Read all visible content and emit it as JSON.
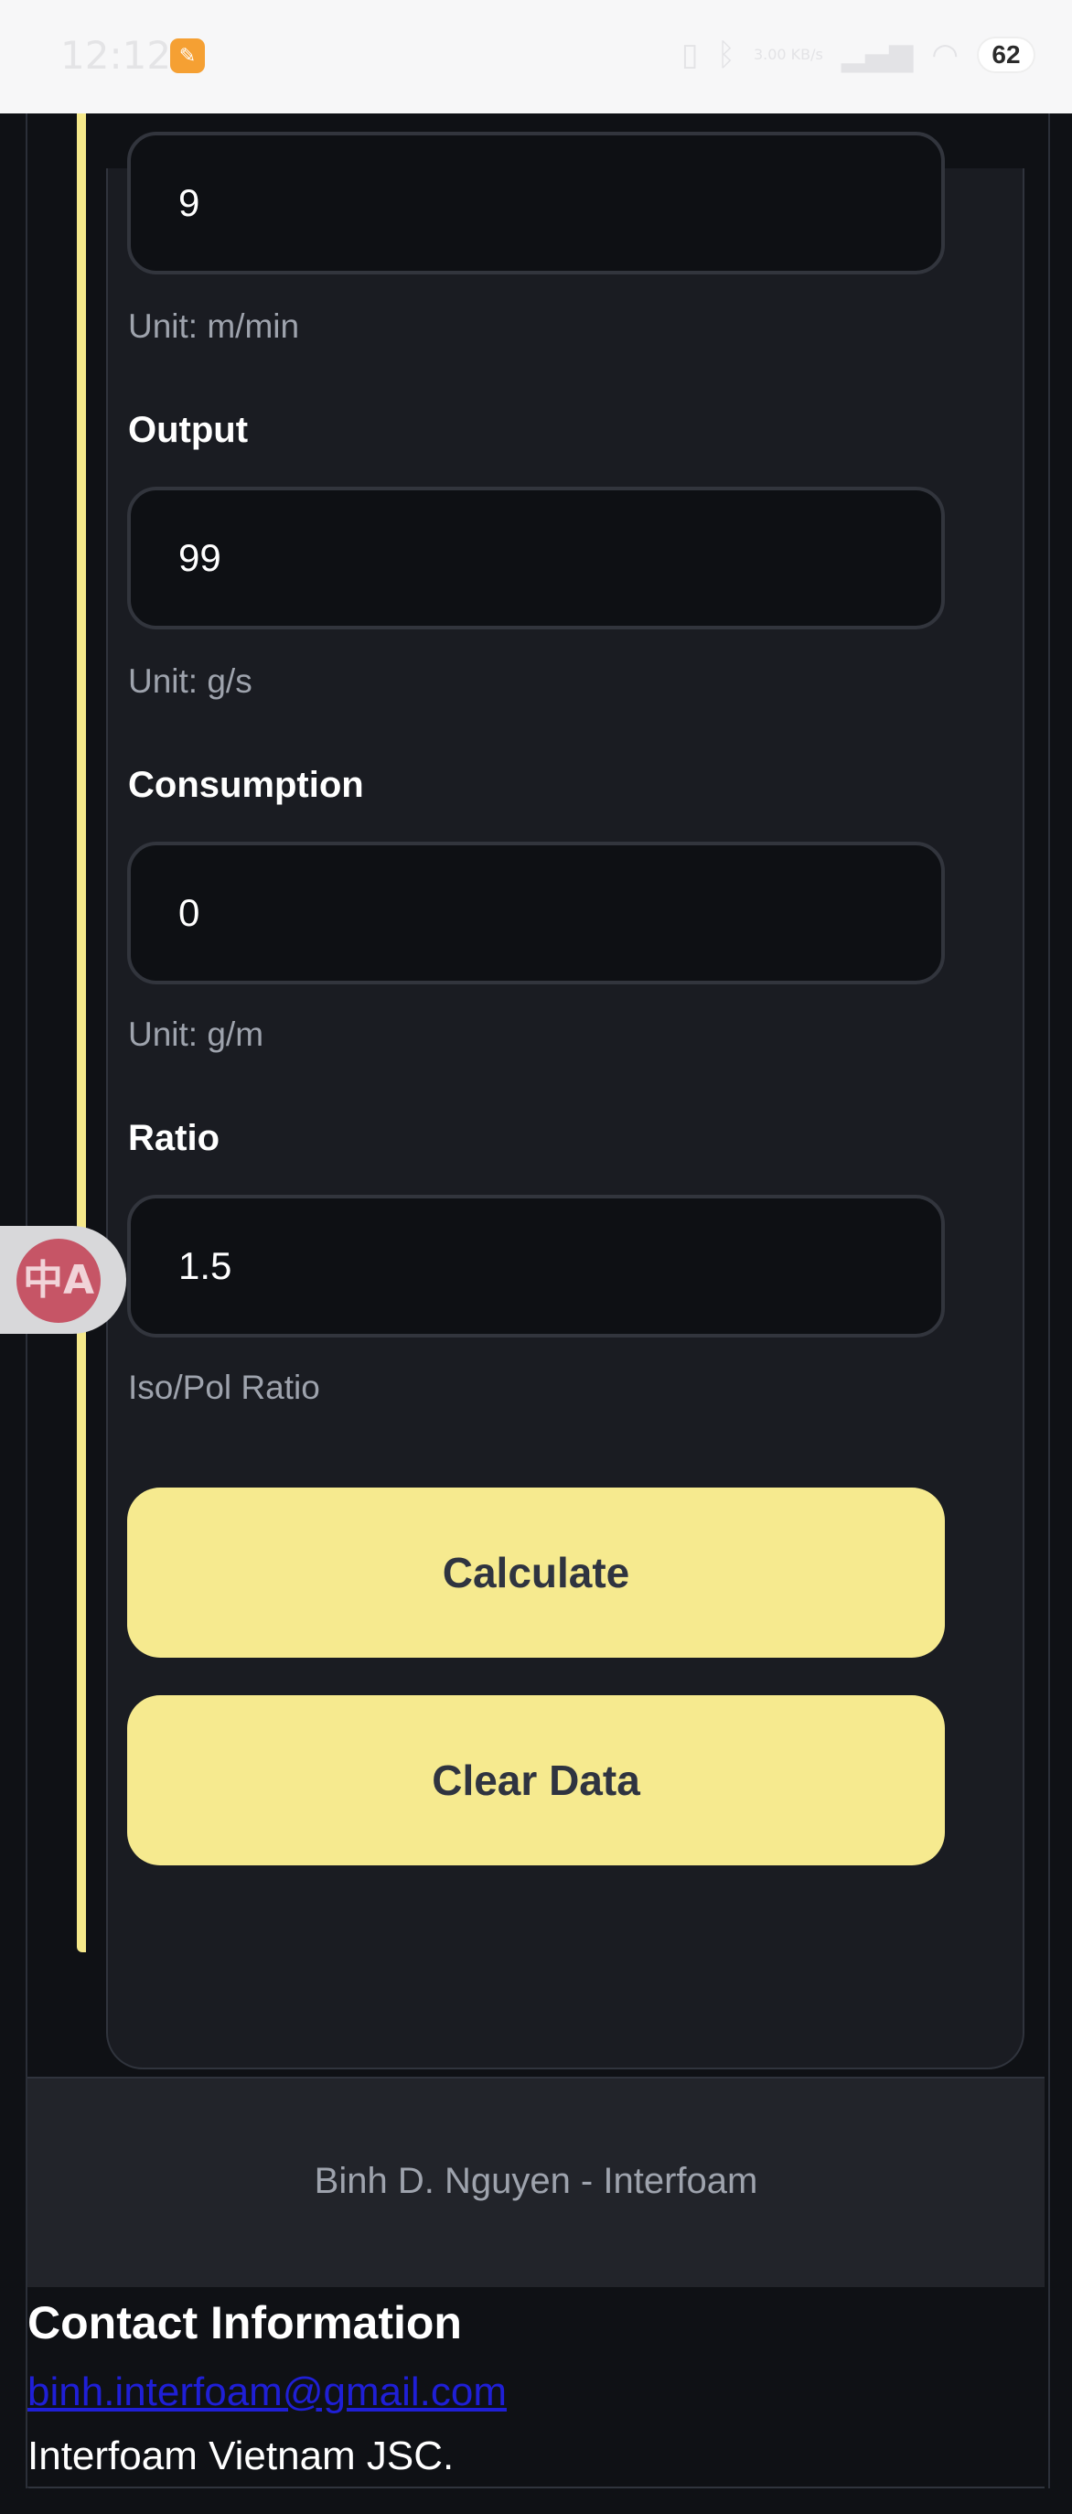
{
  "status_bar": {
    "time": "12:12",
    "icons": [
      "vibrate-icon",
      "bluetooth-icon",
      "data-speed-icon",
      "signal-icon",
      "wifi-icon"
    ],
    "data_speed": "3.00 KB/s",
    "battery": "62"
  },
  "form": {
    "speed": {
      "value": "9",
      "help": "Unit: m/min"
    },
    "output": {
      "label": "Output",
      "value": "99",
      "help": "Unit: g/s"
    },
    "consumption": {
      "label": "Consumption",
      "value": "0",
      "help": "Unit: g/m"
    },
    "ratio": {
      "label": "Ratio",
      "value": "1.5",
      "help": "Iso/Pol Ratio"
    },
    "calculate_label": "Calculate",
    "clear_label": "Clear Data"
  },
  "translate_widget": {
    "glyph": "中A"
  },
  "footer": {
    "credit": "Binh D. Nguyen - Interfoam"
  },
  "contact": {
    "title": "Contact Information",
    "email": "binh.interfoam@gmail.com",
    "company": "Interfoam Vietnam JSC."
  },
  "colors": {
    "accent": "#f6ea8f",
    "background": "#0f1115",
    "card": "#1a1c22",
    "link": "#1f1fd6"
  }
}
